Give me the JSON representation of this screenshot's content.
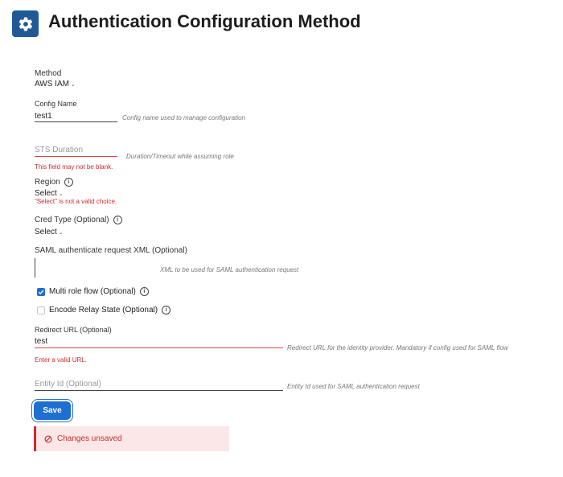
{
  "header": {
    "title": "Authentication Configuration Method",
    "icon": "gear-icon"
  },
  "form": {
    "method": {
      "label": "Method",
      "value": "AWS IAM"
    },
    "config_name": {
      "label": "Config Name",
      "value": "test1",
      "hint": "Config name used to manage configuration"
    },
    "sts_duration": {
      "placeholder": "STS Duration",
      "hint": "Duration/Timeout while assuming role",
      "error": "This field may not be blank."
    },
    "region": {
      "label": "Region",
      "value": "Select",
      "error": "\"Select\" is not a valid choice."
    },
    "cred_type": {
      "label": "Cred Type (Optional)",
      "value": "Select"
    },
    "saml_xml": {
      "label": "SAML authenticate request XML (Optional)",
      "hint": "XML to be used for SAML authentication request"
    },
    "multi_role": {
      "label": "Multi role flow (Optional)",
      "checked": true
    },
    "encode_relay": {
      "label": "Encode Relay State (Optional)",
      "checked": false
    },
    "redirect_url": {
      "label": "Redirect URL (Optional)",
      "value": "test",
      "hint": "Redirect URL for the identity provider. Mandatory if config used for SAML flow",
      "error": "Enter a valid URL."
    },
    "entity_id": {
      "placeholder": "Entity Id (Optional)",
      "hint": "Entity Id used for SAML authentication request"
    }
  },
  "actions": {
    "save_label": "Save"
  },
  "alert": {
    "text": "Changes unsaved"
  },
  "colors": {
    "header_icon_bg": "#1f5a96",
    "primary": "#1d6fd1",
    "error": "#cf2b2b",
    "alert_bg": "#fbe7e7"
  }
}
